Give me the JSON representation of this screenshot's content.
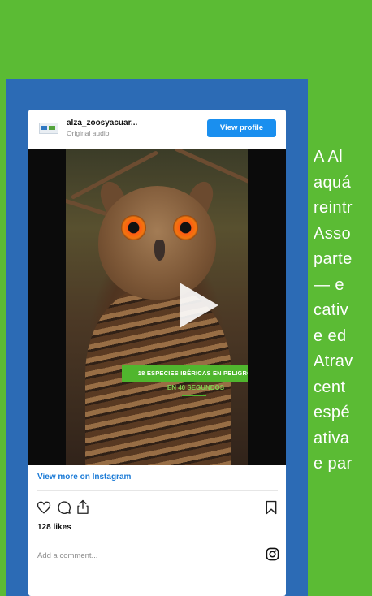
{
  "post": {
    "account_name": "alza_zoosyacuar...",
    "audio_label": "Original audio",
    "view_profile_label": "View profile",
    "video": {
      "banner_text": "18 ESPECIES IBÉRICAS EN PELIGRO",
      "banner_subtext": "EN 40 SEGUNDOS"
    },
    "view_more_label": "View more on Instagram",
    "likes": "128 likes",
    "comment_placeholder": "Add a comment...",
    "icons": [
      "heart-icon",
      "comment-icon",
      "share-icon",
      "bookmark-icon",
      "instagram-icon",
      "play-icon"
    ]
  },
  "article_lines": [
    "A Al",
    "aquá",
    "reintr",
    "Asso",
    "parte",
    "— e",
    "cativ",
    "e ed",
    "Atrav",
    "cent",
    "espé",
    "ativa",
    "e par"
  ],
  "colors": {
    "background_green": "#5bbb34",
    "panel_blue": "#2c6bb5",
    "instagram_blue": "#1a8fef",
    "link_blue": "#1a7ad6",
    "banner_green": "#50b62e"
  }
}
